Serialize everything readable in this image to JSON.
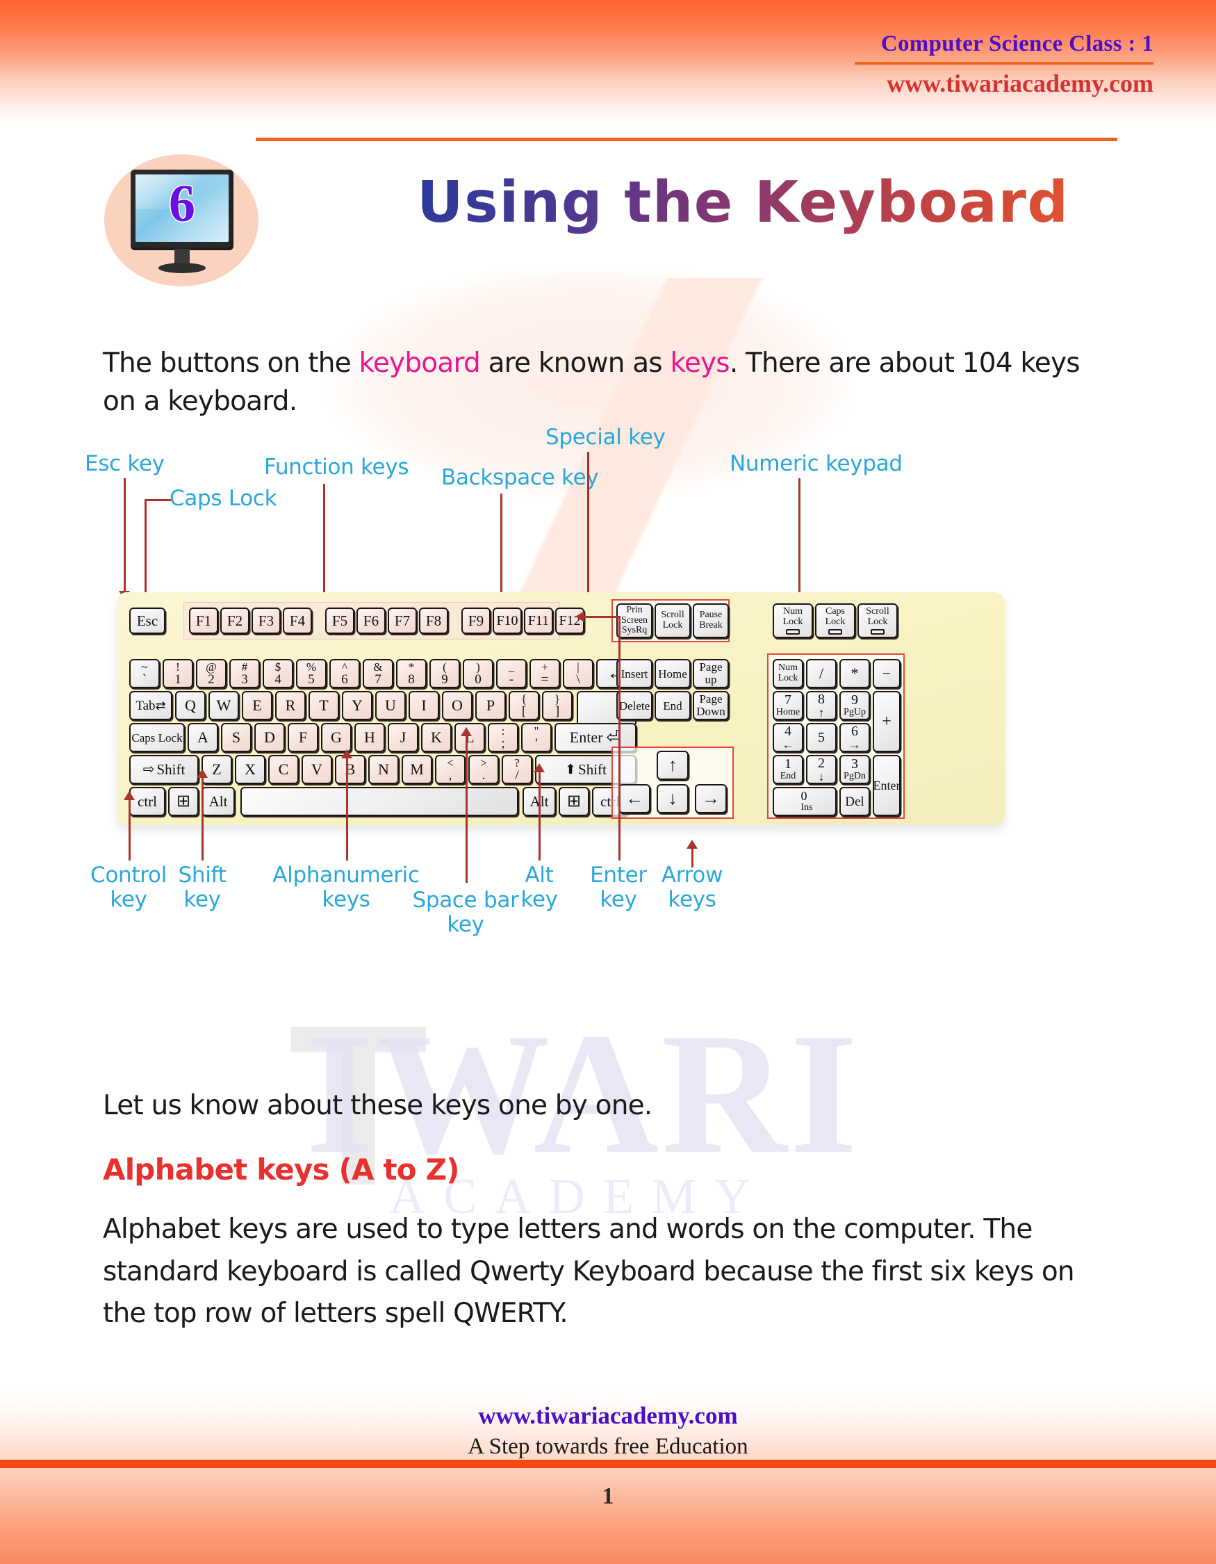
{
  "header": {
    "class_line": "Computer Science Class : 1",
    "website": "www.tiwariacademy.com"
  },
  "title": {
    "chapter_number": "6",
    "heading": "Using the Keyboard"
  },
  "intro": {
    "part1": "The buttons on the ",
    "kw1": "keyboard",
    "part2": " are known as ",
    "kw2": "keys",
    "part3": ". There are about 104 keys on a keyboard."
  },
  "body": {
    "lead": "Let us know about these keys one by one.",
    "section_heading": "Alphabet keys (A to Z)",
    "paragraph": "Alphabet keys are used to type letters and words on the computer. The standard keyboard is called Qwerty Keyboard because the first six keys on the top row of letters spell QWERTY."
  },
  "figure": {
    "labels": {
      "esc": "Esc key",
      "caps": "Caps Lock",
      "function": "Function keys",
      "backspace": "Backspace key",
      "special": "Special key",
      "numpad": "Numeric keypad",
      "control": "Control\nkey",
      "control_l1": "Control",
      "control_l2": "key",
      "shift_l1": "Shift",
      "shift_l2": "key",
      "alpha_l1": "Alphanumeric",
      "alpha_l2": "keys",
      "space_l1": "Space bar",
      "space_l2": "key",
      "alt_l1": "Alt",
      "alt_l2": "key",
      "enter_l1": "Enter",
      "enter_l2": "key",
      "arrow_l1": "Arrow",
      "arrow_l2": "keys"
    },
    "keys": {
      "esc": "Esc",
      "function_row": [
        "F1",
        "F2",
        "F3",
        "F4",
        "F5",
        "F6",
        "F7",
        "F8",
        "F9",
        "F10",
        "F11",
        "F12"
      ],
      "number_row": [
        {
          "top": "~",
          "bottom": "`"
        },
        {
          "top": "!",
          "bottom": "1"
        },
        {
          "top": "@",
          "bottom": "2"
        },
        {
          "top": "#",
          "bottom": "3"
        },
        {
          "top": "$",
          "bottom": "4"
        },
        {
          "top": "%",
          "bottom": "5"
        },
        {
          "top": "^",
          "bottom": "6"
        },
        {
          "top": "&",
          "bottom": "7"
        },
        {
          "top": "*",
          "bottom": "8"
        },
        {
          "top": "(",
          "bottom": "9"
        },
        {
          "top": ")",
          "bottom": "0"
        },
        {
          "top": "_",
          "bottom": "-"
        },
        {
          "top": "+",
          "bottom": "="
        },
        {
          "top": "|",
          "bottom": "\\"
        }
      ],
      "backspace": "←",
      "tab": "Tab",
      "tab_glyph": "⇄",
      "qwerty_row": [
        "Q",
        "W",
        "E",
        "R",
        "T",
        "Y",
        "U",
        "I",
        "O",
        "P"
      ],
      "bracket_open": {
        "top": "{",
        "bottom": "["
      },
      "bracket_close": {
        "top": "}",
        "bottom": "]"
      },
      "caps_lock": "Caps Lock",
      "home_row": [
        "A",
        "S",
        "D",
        "F",
        "G",
        "H",
        "J",
        "K",
        "L"
      ],
      "semicolon": {
        "top": ":",
        "bottom": ";"
      },
      "quote": {
        "top": "\"",
        "bottom": "'"
      },
      "enter": "Enter",
      "enter_glyph": "⏎",
      "shift_left": "Shift",
      "shift_left_glyph": "⇨",
      "bottom_letter_row": [
        "Z",
        "X",
        "C",
        "V",
        "B",
        "N",
        "M"
      ],
      "comma": {
        "top": "<",
        "bottom": ","
      },
      "period": {
        "top": ">",
        "bottom": "."
      },
      "slash": {
        "top": "?",
        "bottom": "/"
      },
      "shift_right": "Shift",
      "shift_right_glyph": "⬆",
      "ctrl": "ctrl",
      "alt": "Alt",
      "win_glyph": "⊞",
      "space": ""
    },
    "special_cluster": [
      {
        "lines": [
          "Prin",
          "Screen",
          "SysRq"
        ]
      },
      {
        "lines": [
          "Scroll",
          "Lock"
        ]
      },
      {
        "lines": [
          "Pause",
          "Break"
        ]
      }
    ],
    "nav_cluster": [
      {
        "lines": [
          "Insert"
        ]
      },
      {
        "lines": [
          "Home"
        ]
      },
      {
        "lines": [
          "Page",
          "up"
        ]
      },
      {
        "lines": [
          "Delete"
        ]
      },
      {
        "lines": [
          "End"
        ]
      },
      {
        "lines": [
          "Page",
          "Down"
        ]
      }
    ],
    "indicator_lights": [
      {
        "lines": [
          "Num",
          "Lock"
        ]
      },
      {
        "lines": [
          "Caps",
          "Lock"
        ]
      },
      {
        "lines": [
          "Scroll",
          "Lock"
        ]
      }
    ],
    "arrow_cluster": {
      "up": "↑",
      "left": "←",
      "down": "↓",
      "right": "→"
    },
    "numpad": {
      "row1": [
        {
          "lines": [
            "Num",
            "Lock"
          ]
        },
        {
          "lines": [
            "/"
          ]
        },
        {
          "lines": [
            "*"
          ]
        },
        {
          "lines": [
            "−"
          ]
        }
      ],
      "row2": [
        {
          "big": "7",
          "small": "Home"
        },
        {
          "big": "8",
          "small": "↑"
        },
        {
          "big": "9",
          "small": "PgUp"
        }
      ],
      "plus": "+",
      "row3": [
        {
          "big": "4",
          "small": "←"
        },
        {
          "big": "5",
          "small": ""
        },
        {
          "big": "6",
          "small": "→"
        }
      ],
      "row4": [
        {
          "big": "1",
          "small": "End"
        },
        {
          "big": "2",
          "small": "↓"
        },
        {
          "big": "3",
          "small": "PgDn"
        }
      ],
      "enter": "Enter",
      "zero": {
        "big": "0",
        "small": "Ins"
      },
      "del": "Del"
    }
  },
  "watermark": {
    "big": "IWARI",
    "t": "T",
    "sub": "ACADEMY"
  },
  "footer": {
    "website": "www.tiwariacademy.com",
    "tagline": "A Step towards free Education",
    "page_number": "1"
  },
  "colors": {
    "accent_orange": "#F4631E",
    "label_blue": "#29A8DC",
    "heading_red": "#E8312F",
    "keyword_pink": "#E8178F",
    "link_purple": "#4B0FC8"
  }
}
